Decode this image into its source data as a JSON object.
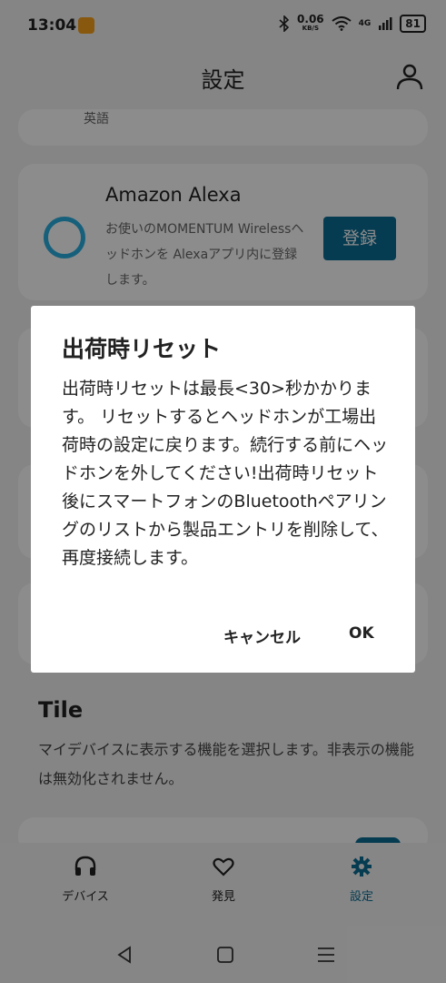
{
  "status_bar": {
    "time": "13:04",
    "net_speed": "0.06",
    "net_unit": "KB/S",
    "network": "4G",
    "battery": "81"
  },
  "topbar": {
    "title": "設定"
  },
  "cards": {
    "top_text": "英語",
    "alexa": {
      "title": "Amazon Alexa",
      "description": "お使いのMOMENTUM Wirelessヘッドホンを Alexaアプリ内に登録します。",
      "button": "登録"
    }
  },
  "tile": {
    "heading": "Tile",
    "description": "マイデバイスに表示する機能を選択します。非表示の機能は無効化されません。"
  },
  "bottom_nav": {
    "items": [
      {
        "label": "デバイス"
      },
      {
        "label": "発見"
      },
      {
        "label": "設定"
      }
    ]
  },
  "dialog": {
    "title": "出荷時リセット",
    "body": "出荷時リセットは最長<30>秒かかります。 リセットするとヘッドホンが工場出荷時の設定に戻ります。続行する前にヘッドホンを外してください!出荷時リセット後にスマートフォンのBluetoothペアリングのリストから製品エントリを削除して、再度接続します。",
    "cancel": "キャンセル",
    "ok": "OK"
  },
  "colors": {
    "accent": "#0b6d94",
    "alexa_ring": "#2bb0e0"
  }
}
